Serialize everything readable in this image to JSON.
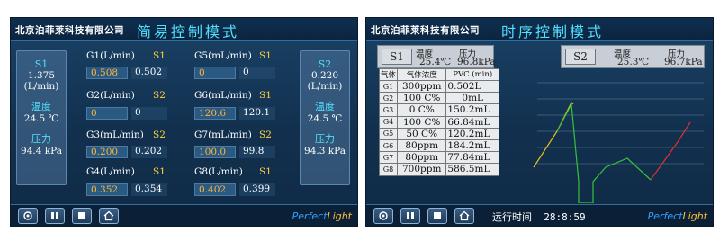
{
  "left": {
    "company": "北京泊菲莱科技有限公司",
    "title": "简易控制模式",
    "s1": {
      "name": "S1",
      "flow": "1.375",
      "flow_unit": "(L/min)",
      "temp_label": "温度",
      "temp": "24.5 ℃",
      "pressure_label": "压力",
      "pressure": "94.4 kPa"
    },
    "s2": {
      "name": "S2",
      "flow": "0.220",
      "flow_unit": "(L/min)",
      "temp_label": "温度",
      "temp": "24.5 ℃",
      "pressure_label": "压力",
      "pressure": "94.3 kPa"
    },
    "channels": [
      {
        "label": "G1(L/min)",
        "source": "S1",
        "set": "0.508",
        "actual": "0.502"
      },
      {
        "label": "G5(mL/min)",
        "source": "S1",
        "set": "0",
        "actual": "0"
      },
      {
        "label": "G2(L/min)",
        "source": "S2",
        "set": "0",
        "actual": "0"
      },
      {
        "label": "G6(mL/min)",
        "source": "S1",
        "set": "120.6",
        "actual": "120.1"
      },
      {
        "label": "G3(mL/min)",
        "source": "S2",
        "set": "0.200",
        "actual": "0.202"
      },
      {
        "label": "G7(mL/min)",
        "source": "S2",
        "set": "100.0",
        "actual": "99.8"
      },
      {
        "label": "G4(L/min)",
        "source": "S1",
        "set": "0.352",
        "actual": "0.354"
      },
      {
        "label": "G8(L/min)",
        "source": "S1",
        "set": "0.402",
        "actual": "0.399"
      }
    ],
    "brand_a": "Perfect",
    "brand_b": "Light"
  },
  "right": {
    "company": "北京泊菲莱科技有限公司",
    "title": "时序控制模式",
    "s1": {
      "name": "S1",
      "temp_label": "温度",
      "temp": "25.4℃",
      "pressure_label": "压力",
      "pressure": "96.8kPa"
    },
    "s2": {
      "name": "S2",
      "temp_label": "温度",
      "temp": "25.3℃",
      "pressure_label": "压力",
      "pressure": "96.7kPa"
    },
    "table_headers": [
      "气体",
      "气体浓度",
      "PVC (min)"
    ],
    "rows": [
      {
        "gas": "G1",
        "conc": "300ppm",
        "pvc": "0.502L"
      },
      {
        "gas": "G2",
        "conc": "100 C%",
        "pvc": "0mL"
      },
      {
        "gas": "G3",
        "conc": "0 C%",
        "pvc": "150.2mL"
      },
      {
        "gas": "G4",
        "conc": "100 C%",
        "pvc": "66.84mL"
      },
      {
        "gas": "G5",
        "conc": "50 C%",
        "pvc": "120.2mL"
      },
      {
        "gas": "G6",
        "conc": "80ppm",
        "pvc": "184.2mL"
      },
      {
        "gas": "G7",
        "conc": "80ppm",
        "pvc": "77.84mL"
      },
      {
        "gas": "G8",
        "conc": "700ppm",
        "pvc": "586.5mL"
      }
    ],
    "run_label": "运行时间",
    "run_time": "28:8:59",
    "brand_a": "Perfect",
    "brand_b": "Light"
  },
  "colors": {
    "title": "#52e0ff",
    "source": "#ffd23a",
    "setpoint": "#ffb43c",
    "trace_green": "#36c23a",
    "trace_red": "#e03030",
    "trace_yellow": "#e8c020"
  }
}
